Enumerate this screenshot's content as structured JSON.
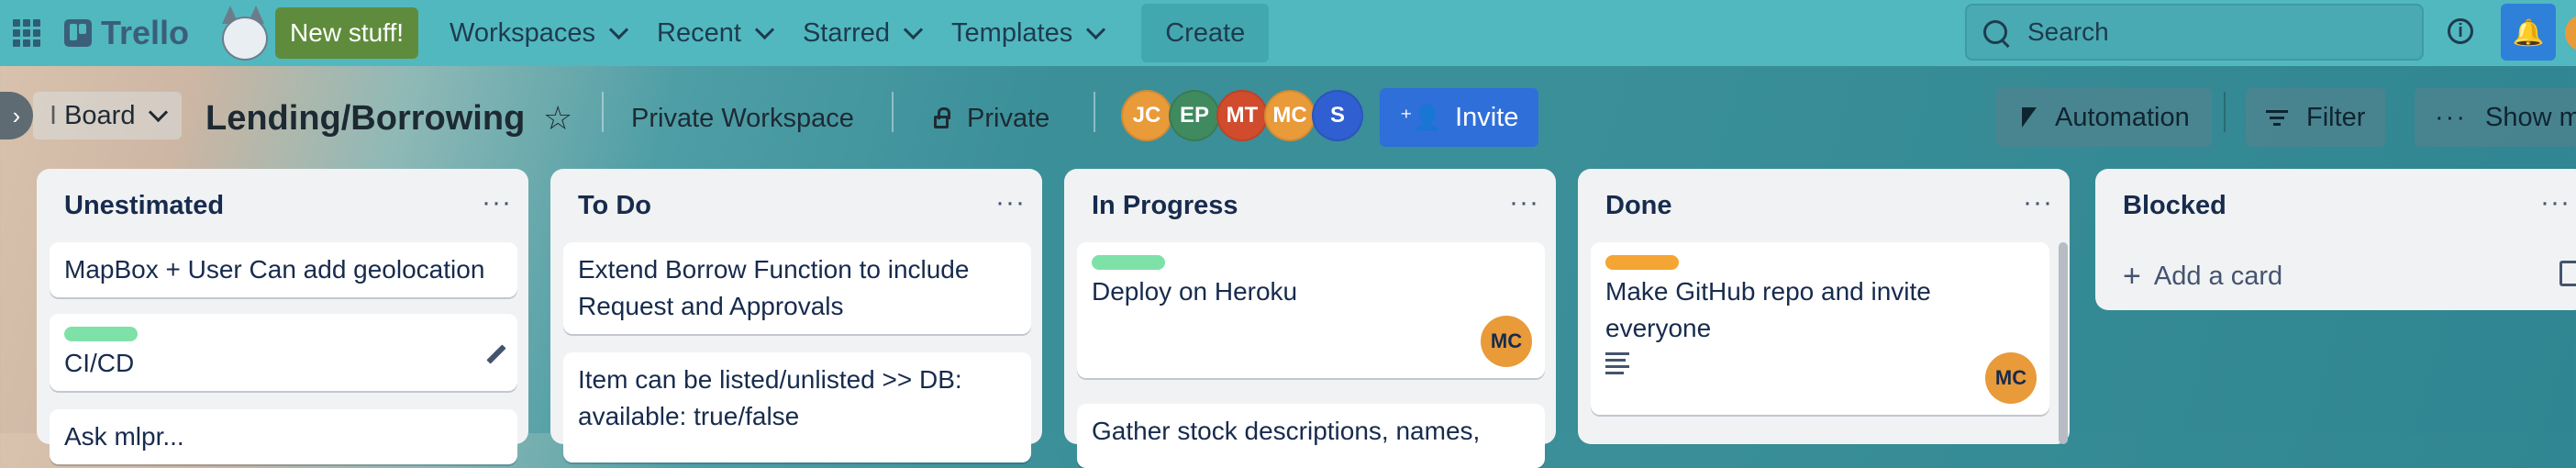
{
  "topbar": {
    "app_name": "Trello",
    "new_stuff": "New stuff!",
    "nav": [
      "Workspaces",
      "Recent",
      "Starred",
      "Templates"
    ],
    "create": "Create",
    "search_placeholder": "Search",
    "info_symbol": "i"
  },
  "board": {
    "view": "Board",
    "view_prefix": "I",
    "title": "Lending/Borrowing",
    "workspace": "Private Workspace",
    "visibility": "Private",
    "members": [
      {
        "initials": "JC",
        "color": "#e99a39"
      },
      {
        "initials": "EP",
        "color": "#3f8a5e"
      },
      {
        "initials": "MT",
        "color": "#d14b2d"
      },
      {
        "initials": "MC",
        "color": "#e99a39"
      },
      {
        "initials": "S",
        "color": "#2f5fd0"
      }
    ],
    "invite": "Invite",
    "automation": "Automation",
    "filter": "Filter",
    "show_menu": "Show menu"
  },
  "lists": [
    {
      "title": "Unestimated",
      "cards": [
        {
          "text": "MapBox + User Can add geolocation"
        },
        {
          "text": "CI/CD",
          "label": "#7ee2a8"
        },
        {
          "text": "Ask mlpr..."
        }
      ]
    },
    {
      "title": "To Do",
      "cards": [
        {
          "text": "Extend Borrow Function to include Request and Approvals"
        },
        {
          "text": "Item can be listed/unlisted >> DB: available: true/false"
        }
      ]
    },
    {
      "title": "In Progress",
      "cards": [
        {
          "text": "Deploy on Heroku",
          "label": "#7ee2a8",
          "member": "MC"
        },
        {
          "text": "Gather stock descriptions, names,"
        }
      ]
    },
    {
      "title": "Done",
      "cards": [
        {
          "text": "Make GitHub repo and invite everyone",
          "label": "#f5a533",
          "member": "MC"
        }
      ]
    },
    {
      "title": "Blocked",
      "add_card": "Add a card"
    }
  ],
  "list_menu_symbol": "···"
}
